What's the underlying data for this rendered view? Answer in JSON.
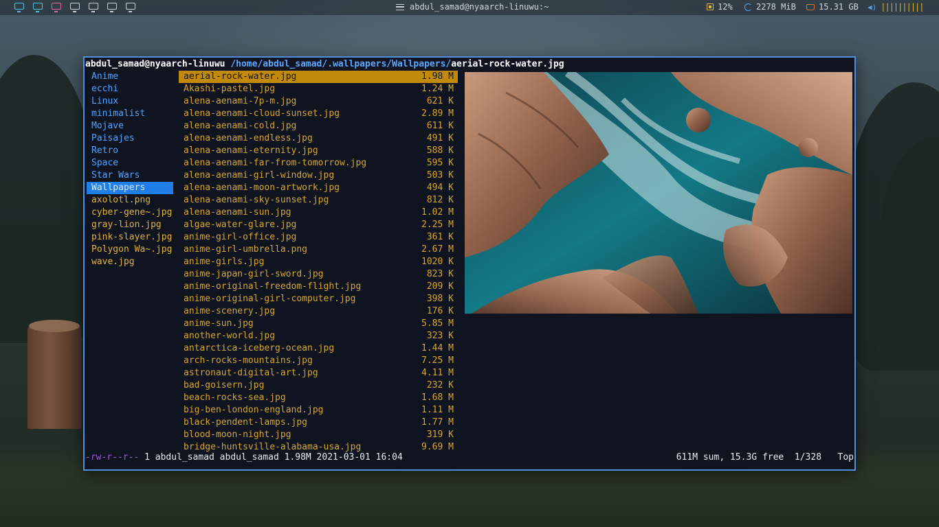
{
  "topbar": {
    "workspaces": [
      "ws1",
      "ws2",
      "ws3",
      "ws4",
      "ws5",
      "ws6",
      "ws7"
    ],
    "window_title": "abdul_samad@nyaarch-linuwu:~",
    "cpu": "12%",
    "memory": "2278 MiB",
    "disk": "15.31 GB",
    "volume_bars": "||||||||||"
  },
  "terminal": {
    "prompt_user": "abdul_samad@nyaarch-linuwu",
    "path": "/home/abdul_samad/.wallpapers/Wallpapers/",
    "current_file": "aerial-rock-water.jpg",
    "dirs": [
      {
        "name": "Anime"
      },
      {
        "name": "ecchi"
      },
      {
        "name": "Linux"
      },
      {
        "name": "minimalist"
      },
      {
        "name": "Mojave"
      },
      {
        "name": "Paisajes"
      },
      {
        "name": "Retro"
      },
      {
        "name": "Space"
      },
      {
        "name": "Star Wars"
      },
      {
        "name": "Wallpapers"
      }
    ],
    "parent_files": [
      {
        "name": "axolotl.png"
      },
      {
        "name": "cyber-gene~.jpg"
      },
      {
        "name": "gray-lion.jpg"
      },
      {
        "name": "pink-slayer.jpg"
      },
      {
        "name": "Polygon Wa~.jpg"
      },
      {
        "name": "wave.jpg"
      }
    ],
    "files": [
      {
        "name": "aerial-rock-water.jpg",
        "size": "1.98 M"
      },
      {
        "name": "Akashi-pastel.jpg",
        "size": "1.24 M"
      },
      {
        "name": "alena-aenami-7p-m.jpg",
        "size": "621 K"
      },
      {
        "name": "alena-aenami-cloud-sunset.jpg",
        "size": "2.89 M"
      },
      {
        "name": "alena-aenami-cold.jpg",
        "size": "611 K"
      },
      {
        "name": "alena-aenami-endless.jpg",
        "size": "491 K"
      },
      {
        "name": "alena-aenami-eternity.jpg",
        "size": "588 K"
      },
      {
        "name": "alena-aenami-far-from-tomorrow.jpg",
        "size": "595 K"
      },
      {
        "name": "alena-aenami-girl-window.jpg",
        "size": "503 K"
      },
      {
        "name": "alena-aenami-moon-artwork.jpg",
        "size": "494 K"
      },
      {
        "name": "alena-aenami-sky-sunset.jpg",
        "size": "812 K"
      },
      {
        "name": "alena-aenami-sun.jpg",
        "size": "1.02 M"
      },
      {
        "name": "algae-water-glare.jpg",
        "size": "2.25 M"
      },
      {
        "name": "anime-girl-office.jpg",
        "size": "361 K"
      },
      {
        "name": "anime-girl-umbrella.png",
        "size": "2.67 M"
      },
      {
        "name": "anime-girls.jpg",
        "size": "1020 K"
      },
      {
        "name": "anime-japan-girl-sword.jpg",
        "size": "823 K"
      },
      {
        "name": "anime-original-freedom-flight.jpg",
        "size": "209 K"
      },
      {
        "name": "anime-original-girl-computer.jpg",
        "size": "398 K"
      },
      {
        "name": "anime-scenery.jpg",
        "size": "176 K"
      },
      {
        "name": "anime-sun.jpg",
        "size": "5.85 M"
      },
      {
        "name": "another-world.jpg",
        "size": "323 K"
      },
      {
        "name": "antarctica-iceberg-ocean.jpg",
        "size": "1.44 M"
      },
      {
        "name": "arch-rocks-mountains.jpg",
        "size": "7.25 M"
      },
      {
        "name": "astronaut-digital-art.jpg",
        "size": "4.11 M"
      },
      {
        "name": "bad-goisern.jpg",
        "size": "232 K"
      },
      {
        "name": "beach-rocks-sea.jpg",
        "size": "1.68 M"
      },
      {
        "name": "big-ben-london-england.jpg",
        "size": "1.11 M"
      },
      {
        "name": "black-pendent-lamps.jpg",
        "size": "1.77 M"
      },
      {
        "name": "blood-moon-night.jpg",
        "size": "319 K"
      },
      {
        "name": "bridge-huntsville-alabama-usa.jpg",
        "size": "9.69 M"
      }
    ],
    "status": {
      "permissions": "-rw-r--r--",
      "info": " 1 abdul_samad abdul_samad 1.98M 2021-03-01 16:04",
      "summary": "611M sum, 15.3G free  1/328   Top"
    }
  },
  "colors": {
    "border": "#4f8fe0",
    "dir_blue": "#4ea6ff",
    "file_gold": "#d6a730",
    "selected_file_bg": "#c18a0b",
    "selected_dir_bg": "#1f7fe6",
    "permissions_purple": "#9b5ad6"
  }
}
